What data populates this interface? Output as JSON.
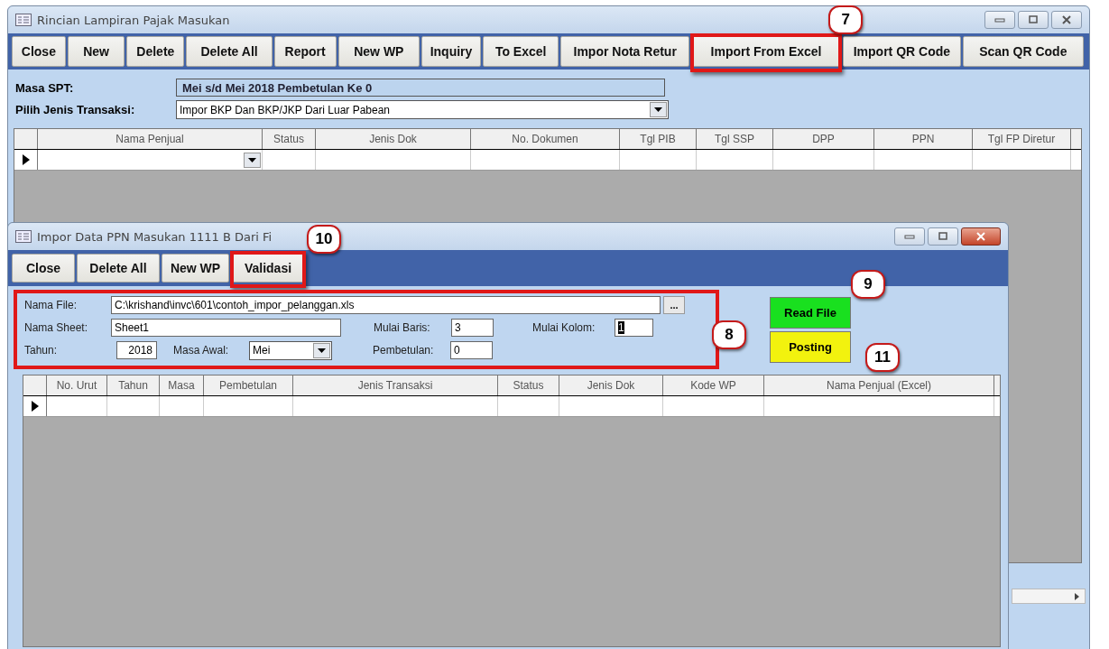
{
  "main_window": {
    "title": "Rincian Lampiran Pajak Masukan",
    "toolbar": [
      {
        "label": "Close"
      },
      {
        "label": "New"
      },
      {
        "label": "Delete"
      },
      {
        "label": "Delete All"
      },
      {
        "label": "Report"
      },
      {
        "label": "New WP"
      },
      {
        "label": "Inquiry"
      },
      {
        "label": "To Excel"
      },
      {
        "label": "Impor Nota Retur"
      },
      {
        "label": "Import From Excel",
        "callout": "7"
      },
      {
        "label": "Import QR Code"
      },
      {
        "label": "Scan QR Code"
      }
    ],
    "masa_spt": {
      "label": "Masa SPT:",
      "value": "Mei s/d Mei 2018  Pembetulan Ke 0"
    },
    "jenis_transaksi": {
      "label": "Pilih Jenis Transaksi:",
      "value": "Impor BKP Dan BKP/JKP Dari Luar Pabean"
    },
    "table": {
      "columns": [
        "Nama Penjual",
        "Status",
        "Jenis Dok",
        "No. Dokumen",
        "Tgl PIB",
        "Tgl SSP",
        "DPP",
        "PPN",
        "Tgl FP Diretur"
      ]
    }
  },
  "import_window": {
    "title": "Impor Data PPN Masukan 1111 B Dari Fi",
    "toolbar": [
      {
        "label": "Close"
      },
      {
        "label": "Delete All"
      },
      {
        "label": "New WP"
      },
      {
        "label": "Validasi",
        "callout": "10"
      }
    ],
    "form": {
      "callout": "8",
      "nama_file": {
        "label": "Nama File:",
        "value": "C:\\krishand\\invc\\601\\contoh_impor_pelanggan.xls",
        "browse": "..."
      },
      "nama_sheet": {
        "label": "Nama Sheet:",
        "value": "Sheet1"
      },
      "mulai_baris": {
        "label": "Mulai Baris:",
        "value": "3"
      },
      "mulai_kolom": {
        "label": "Mulai Kolom:",
        "value": "1"
      },
      "tahun": {
        "label": "Tahun:",
        "value": "2018"
      },
      "masa_awal": {
        "label": "Masa Awal:",
        "value": "Mei"
      },
      "pembetulan": {
        "label": "Pembetulan:",
        "value": "0"
      }
    },
    "read_file": {
      "label": "Read File",
      "callout": "9"
    },
    "posting": {
      "label": "Posting",
      "callout": "11"
    },
    "table": {
      "columns": [
        "No. Urut",
        "Tahun",
        "Masa",
        "Pembetulan",
        "Jenis Transaksi",
        "Status",
        "Jenis Dok",
        "Kode WP",
        "Nama Penjual (Excel)"
      ]
    }
  }
}
